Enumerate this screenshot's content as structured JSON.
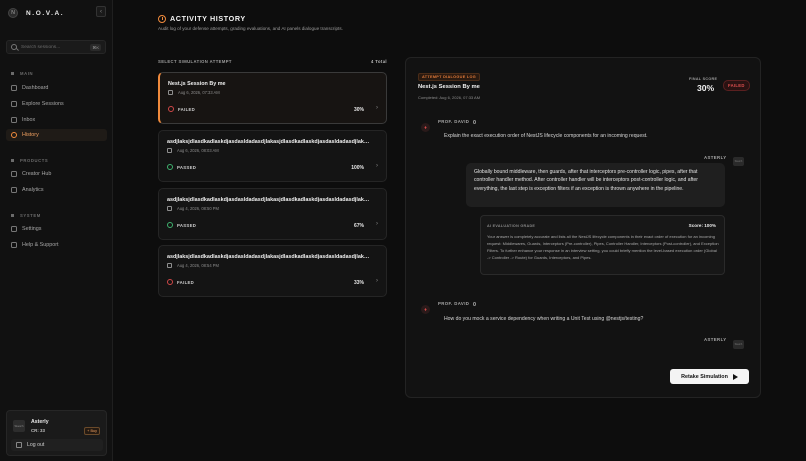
{
  "brand": {
    "name": "N.O.V.A.",
    "logo": "N"
  },
  "sidebar": {
    "search_placeholder": "Search sessions...",
    "search_shortcut": "⌘K",
    "sections": {
      "main": "MAIN",
      "products": "PRODUCTS",
      "system": "SYSTEM"
    },
    "items": [
      {
        "label": "Dashboard",
        "icon": "grid-icon"
      },
      {
        "label": "Explore Sessions",
        "icon": "compass-icon"
      },
      {
        "label": "Inbox",
        "icon": "inbox-icon"
      },
      {
        "label": "History",
        "icon": "clock-icon",
        "active": true
      },
      {
        "label": "Creator Hub",
        "icon": "hub-icon"
      },
      {
        "label": "Analytics",
        "icon": "analytics-icon"
      },
      {
        "label": "Settings",
        "icon": "gear-icon"
      },
      {
        "label": "Help & Support",
        "icon": "help-icon"
      }
    ],
    "user": {
      "name": "Asterly",
      "credits": "CR: 33",
      "buy": "+ Buy",
      "avatar": "Sketch"
    },
    "logout": "Log out"
  },
  "page": {
    "title": "ACTIVITY HISTORY",
    "subtitle": "Audit log of your defense attempts, grading evaluations, and AI panels dialogue transcripts."
  },
  "attempts": {
    "header": "SELECT SIMULATION ATTEMPT",
    "total": "4 Total",
    "items": [
      {
        "title": "Nest.js Session By me",
        "date": "Aug 6, 2026, 07:33 AM",
        "status": "FAILED",
        "score": "30%"
      },
      {
        "title": "asdjlaksjdlasdkadlaskdjasdasldadasdjlakasjdlasdkadlaskdjasdasldadasdjlakasjdlasdkadlaskdjasdasldadasdj...",
        "date": "Aug 6, 2026, 08:03 AM",
        "status": "PASSED",
        "score": "100%"
      },
      {
        "title": "asdjlaksjdlasdkadlaskdjasdasldadasdjlakasjdlasdkadlaskdjasdasldadasdjlakasjdlasdkadlaskdjasdasldadasdj...",
        "date": "Aug 4, 2026, 08:50 PM",
        "status": "PASSED",
        "score": "67%"
      },
      {
        "title": "asdjlaksjdlasdkadlaskdjasdasldadasdjlakasjdlasdkadlaskdjasdasldadasdjlakasjdlasdkadlaskdjasdasldadasdj...",
        "date": "Aug 4, 2026, 08:54 PM",
        "status": "FAILED",
        "score": "33%"
      }
    ]
  },
  "detail": {
    "badge": "ATTEMPT DIALOGUE LOG",
    "title": "Nest.js Session By me",
    "completed": "Completed: Aug 6, 2026, 07:33 AM",
    "final_score_label": "FINAL SCORE",
    "final_score": "30%",
    "result_badge": "FAILED",
    "professor": "PROF. DAVID",
    "asterly": "ASTERLY",
    "asterly_avatar": "Sketch",
    "question1": "Explain the exact execution order of NestJS lifecycle components for an incoming request.",
    "answer1": "Globally bound middleware, then guards, after that interceptors pre-controller logic, pipes, after that controller handler method. After controller handler will be interceptors post-controller logic, and after everything, the last step is exception filters if an exception is thrown anywhere in the pipeline.",
    "eval_label": "AI EVALUATION GRADE",
    "eval_score": "Score: 100%",
    "eval_text": "Your answer is completely accurate and lists all the NestJS lifecycle components in their exact order of execution for an incoming request: Middlewares, Guards, Interceptors (Pre-controller), Pipes, Controller Handler, Interceptors (Post-controller), and Exception Filters. To further enhance your response in an interview setting, you could briefly mention the level-based execution order (Global -> Controller -> Route) for Guards, Interceptors, and Pipes.",
    "question2": "How do you mock a service dependency when writing a Unit Test using @nestjs/testing?",
    "retake": "Retake Simulation"
  },
  "colors": {
    "accent": "#f08a3c",
    "fail": "#d04848",
    "pass": "#3fb36f"
  }
}
